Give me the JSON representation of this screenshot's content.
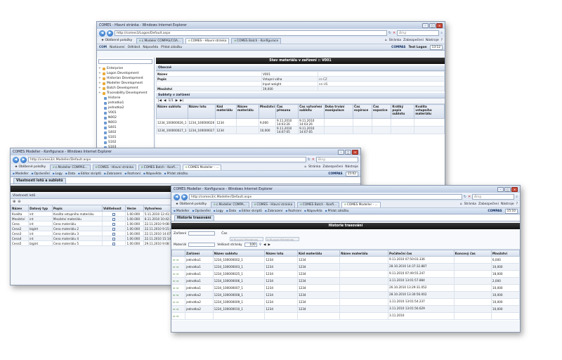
{
  "colors": {
    "title_gradient": "#bccbe2",
    "section_blue": "#1e3b6b",
    "header_black": "#111111",
    "tab_ie_green": "#3a7d2c"
  },
  "win1": {
    "title": "COMES - Hlavní stránka - Windows Internet Explorer",
    "url": "http://comes3/Logon/Default.aspx",
    "search_placeholder": "Bing",
    "favorites": "Oblíbené položky",
    "tabs": [
      "c.Modeler COMPAS/COA...",
      "COMES - Hlavní stránka",
      "COMES Batch - Konfigurace"
    ],
    "menu": [
      "Stránka",
      "Zabezpečení",
      "Nástroje"
    ],
    "app_brand": "COM",
    "app_toolbar": [
      "Nastavení",
      "Odhlásit",
      "Nápověda",
      "Přidat záložku"
    ],
    "app_right_brand": "COMPAS",
    "user": "Test Logon",
    "clock": "13:12",
    "section_title": "Stav materiálu v zařízení :: V001",
    "sidebar_items": [
      {
        "label": "Enterprise",
        "level": 1
      },
      {
        "label": "Logon Development",
        "level": 1
      },
      {
        "label": "Historian Development",
        "level": 1
      },
      {
        "label": "Modeller Development",
        "level": 1
      },
      {
        "label": "Batch Development",
        "level": 1
      },
      {
        "label": "Traceability Development",
        "level": 1
      },
      {
        "label": "Historie",
        "level": 2
      },
      {
        "label": "jednotka1",
        "level": 2
      },
      {
        "label": "jednotka2",
        "level": 2
      },
      {
        "label": "V001",
        "level": 2
      },
      {
        "label": "N002",
        "level": 2
      },
      {
        "label": "N003",
        "level": 2
      },
      {
        "label": "S401",
        "level": 2
      },
      {
        "label": "S402",
        "level": 2
      },
      {
        "label": "S101",
        "level": 2
      },
      {
        "label": "S102",
        "level": 2
      },
      {
        "label": "S103",
        "level": 2
      }
    ],
    "general_head": "Obecné",
    "general": [
      {
        "label": "Název",
        "value": "V001",
        "extra": ""
      },
      {
        "label": "Popis",
        "value": "Vstupní váha",
        "extra": "cs-CZ"
      },
      {
        "label": "",
        "value": "Input weight",
        "extra": "en-US"
      },
      {
        "label": "Množství",
        "value": "19,000",
        "extra": ""
      }
    ],
    "sublots_head": "Subloty v zařízení",
    "pager": "1/1",
    "sublot_columns": [
      "Název sublotu",
      "Název lotu",
      "Kód materiálu",
      "Název materiálu",
      "Množství",
      "Čas přesunu",
      "Čas vytvoření sublotu",
      "Doba trvání manipulace",
      "Čas expirace",
      "Čas expozice",
      "Krátký popis sublotu",
      "Kvalita vstupního materiálu"
    ],
    "sublot_rows": [
      [
        "1234_100000026_1",
        "1234_100000026",
        "1234",
        "",
        "9,000",
        "9.11.2010 14:03:26",
        "9.11.2010 14:03:26",
        "",
        "",
        "",
        "",
        ""
      ],
      [
        "1234_100000027_1",
        "1234_100000027",
        "1234",
        "",
        "10,000",
        "9.11.2010 14:07:05",
        "9.11.2010 14:07:05",
        "",
        "",
        "",
        "",
        ""
      ]
    ]
  },
  "win2": {
    "title": "COMES Modeller - Konfigurace - Windows Internet Explorer",
    "url": "http://comes3/c.Modeller/Default.aspx",
    "search_placeholder": "Bing",
    "favorites": "Oblíbené položky",
    "tabs": [
      "c.Modeller COMPAS...",
      "COMES - Hlavní stránka",
      "COMES Batch - Konfi...",
      "COMES Modeller - ..."
    ],
    "menu": [
      "Stránka",
      "Zabezpečení",
      "Nástroje"
    ],
    "app_toolbar": [
      "Modeller",
      "Oprávnění",
      "Logy",
      "Data",
      "Editor skriptů",
      "Zobrazení",
      "Rozhraní",
      "Nápověda",
      "Přidat záložku"
    ],
    "app_right_brand": "COMPAS",
    "clock": "15:02",
    "page_tab": "Vlastnosti lotů a sublotů",
    "panel_head": "Vlastnosti lotů",
    "columns": [
      "Název",
      "Datový typ",
      "Popis",
      "Viditelnost",
      "Verze",
      "Vytvořeno"
    ],
    "rows": [
      [
        "Kvalita",
        "int",
        "Kvalita vstupního materiálu",
        "1.00.000",
        "5.11.2010 12:41:14"
      ],
      [
        "Množství",
        "int",
        "Množství materiálu",
        "1.00.000",
        "8.11.2010 10:42:31"
      ],
      [
        "Cena",
        "int",
        "Cena materiálu",
        "1.00.000",
        "22.11.2010 9:08:55"
      ],
      [
        "Cena2",
        "bigint",
        "Cena materiálu 2",
        "1.00.000",
        "22.11.2010 9:15:48"
      ],
      [
        "Cena3",
        "int",
        "Cena materiálu 3",
        "1.00.000",
        "22.11.2010 14:07:23"
      ],
      [
        "Cena4",
        "int",
        "Cena materiálu 4",
        "1.00.000",
        "22.11.2010 15:14:15"
      ],
      [
        "Cena5",
        "bigint",
        "Cena materiálu 5",
        "1.00.000",
        "29.11.2010 9:08:18"
      ]
    ]
  },
  "win3": {
    "title": "COMES Modeller - Konfigurace - Windows Internet Explorer",
    "url": "http://comes3/c.Modeller/Default.aspx",
    "search_placeholder": "Bing",
    "favorites": "Oblíbené položky",
    "tabs": [
      "c.Modeller COMPA...",
      "COMES - Hlavní stránka",
      "COMES Batch - Konfi...",
      "COMES Modeller - ..."
    ],
    "menu": [
      "Stránka",
      "Zabezpečení",
      "Nástroje"
    ],
    "app_toolbar": [
      "Modeller",
      "Oprávnění",
      "Logy",
      "Data",
      "Editor skriptů",
      "Zobrazení",
      "Rozhraní",
      "Nápověda",
      "Přidat záložku"
    ],
    "app_right_brand": "COMPAS",
    "clock": "15:10",
    "page_tab": "Historie trasování",
    "section_title": "Historie trasování",
    "filters": {
      "device_label": "Zařízení",
      "time_label": "Čas",
      "material_label": "Materiál",
      "page_size_label": "Velikost stránky",
      "page_size_value": "100",
      "dt_placeholder": "d.M.yyyy HH:mm:ss"
    },
    "columns": [
      "Zařízení",
      "Název sublotu",
      "Název lotu",
      "Kód materiálu",
      "Název materiálu",
      "Počáteční čas",
      "Koncový čas",
      "Množství"
    ],
    "rows": [
      [
        "jednotka1",
        "1234_100000002_1",
        "1234",
        "1234",
        "9.11.2010 07:50:03.336",
        "",
        "6,000"
      ],
      [
        "jednotka1",
        "1234_100000003_1",
        "1234",
        "1234",
        "28.10.2010 14:37:32.887",
        "",
        "10,000"
      ],
      [
        "jednotka1",
        "1234_100000025_1",
        "1234",
        "1234",
        "9.11.2010 07:49:55.247",
        "",
        "18,000"
      ],
      [
        "jednotka1",
        "1234_100000006_1",
        "1234",
        "1234",
        "3.11.2010 13:01:57.884",
        "",
        "2,000"
      ],
      [
        "jednotka1",
        "1234_100000007_1",
        "1234",
        "1234",
        "26.10.2010 13:29:31.052",
        "",
        "10,000"
      ],
      [
        "jednotka2",
        "1234_100000008_1",
        "1234",
        "1234",
        "28.10.2010 13:30:56.002",
        "",
        "10,000"
      ],
      [
        "jednotka2",
        "1234_100000009_1",
        "1234",
        "1234",
        "3.11.2010 13:01:54.237",
        "",
        "10,000"
      ],
      [
        "jednotka2",
        "1234_100000010_1",
        "1234",
        "1234",
        "3.11.2010 13:01:56.629",
        "",
        "10,000"
      ],
      [
        "",
        "",
        "",
        "",
        "3.11.2010",
        "",
        ""
      ]
    ]
  }
}
